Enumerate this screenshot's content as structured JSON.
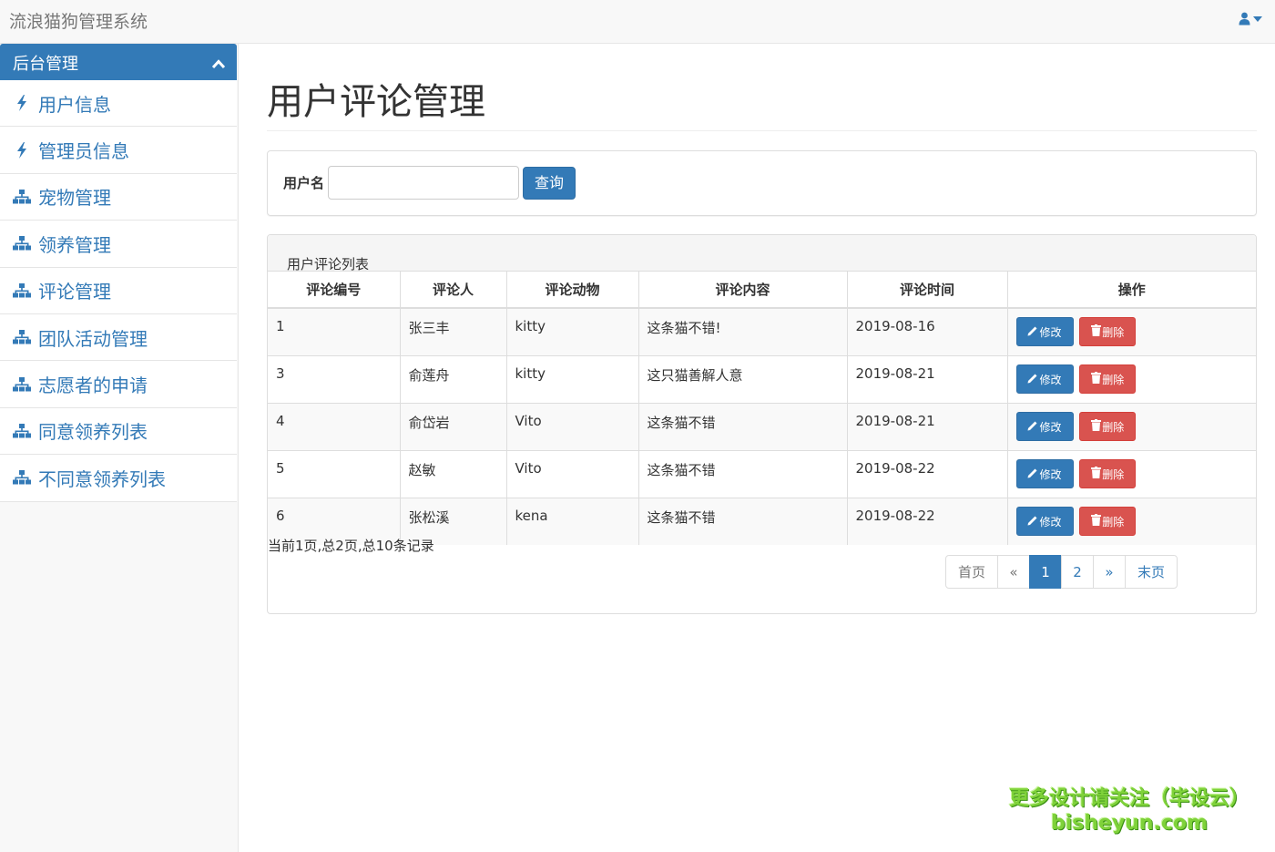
{
  "app": {
    "brand": "流浪猫狗管理系统"
  },
  "header": {
    "user_icon": "user-icon"
  },
  "sidebar": {
    "title": "后台管理",
    "items": [
      {
        "label": "用户信息",
        "icon": "bolt-icon"
      },
      {
        "label": "管理员信息",
        "icon": "bolt-icon"
      },
      {
        "label": "宠物管理",
        "icon": "sitemap-icon"
      },
      {
        "label": "领养管理",
        "icon": "sitemap-icon"
      },
      {
        "label": "评论管理",
        "icon": "sitemap-icon"
      },
      {
        "label": "团队活动管理",
        "icon": "sitemap-icon"
      },
      {
        "label": "志愿者的申请",
        "icon": "sitemap-icon"
      },
      {
        "label": "同意领养列表",
        "icon": "sitemap-icon"
      },
      {
        "label": "不同意领养列表",
        "icon": "sitemap-icon"
      }
    ]
  },
  "main": {
    "title": "用户评论管理",
    "search": {
      "label": "用户名",
      "value": "",
      "button": "查询"
    },
    "list": {
      "heading": "用户评论列表",
      "columns": [
        "评论编号",
        "评论人",
        "评论动物",
        "评论内容",
        "评论时间",
        "操作"
      ],
      "rows": [
        {
          "id": "1",
          "user": "张三丰",
          "animal": "kitty",
          "content": "这条猫不错!",
          "time": "2019-08-16"
        },
        {
          "id": "3",
          "user": "俞莲舟",
          "animal": "kitty",
          "content": "这只猫善解人意",
          "time": "2019-08-21"
        },
        {
          "id": "4",
          "user": "俞岱岩",
          "animal": "Vito",
          "content": "这条猫不错",
          "time": "2019-08-21"
        },
        {
          "id": "5",
          "user": "赵敏",
          "animal": "Vito",
          "content": "这条猫不错",
          "time": "2019-08-22"
        },
        {
          "id": "6",
          "user": "张松溪",
          "animal": "kena",
          "content": "这条猫不错",
          "time": "2019-08-22"
        }
      ],
      "edit_label": "修改",
      "delete_label": "删除",
      "record_info": "当前1页,总2页,总10条记录",
      "pagination": {
        "first": "首页",
        "prev": "«",
        "pages": [
          "1",
          "2"
        ],
        "current": "1",
        "next": "»",
        "last": "末页"
      }
    }
  },
  "watermark": {
    "line1": "更多设计请关注（毕设云）",
    "line2": "bisheyun.com"
  },
  "colors": {
    "primary": "#337ab7",
    "danger": "#d9534f",
    "watermark": "#7fd23a"
  }
}
